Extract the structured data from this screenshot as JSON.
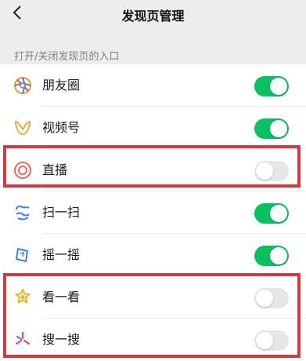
{
  "header": {
    "title": "发现页管理"
  },
  "section": {
    "label": "打开/关闭发现页的入口"
  },
  "items": [
    {
      "label": "朋友圈",
      "enabled": true,
      "icon": "moments-icon"
    },
    {
      "label": "视频号",
      "enabled": true,
      "icon": "channels-icon"
    },
    {
      "label": "直播",
      "enabled": false,
      "icon": "live-icon"
    },
    {
      "label": "扫一扫",
      "enabled": true,
      "icon": "scan-icon"
    },
    {
      "label": "摇一摇",
      "enabled": true,
      "icon": "shake-icon"
    },
    {
      "label": "看一看",
      "enabled": false,
      "icon": "top-stories-icon"
    },
    {
      "label": "搜一搜",
      "enabled": false,
      "icon": "search-icon"
    }
  ],
  "colors": {
    "toggle_on": "#07c160",
    "toggle_off": "#e6e6e6",
    "highlight": "#d9363e"
  }
}
